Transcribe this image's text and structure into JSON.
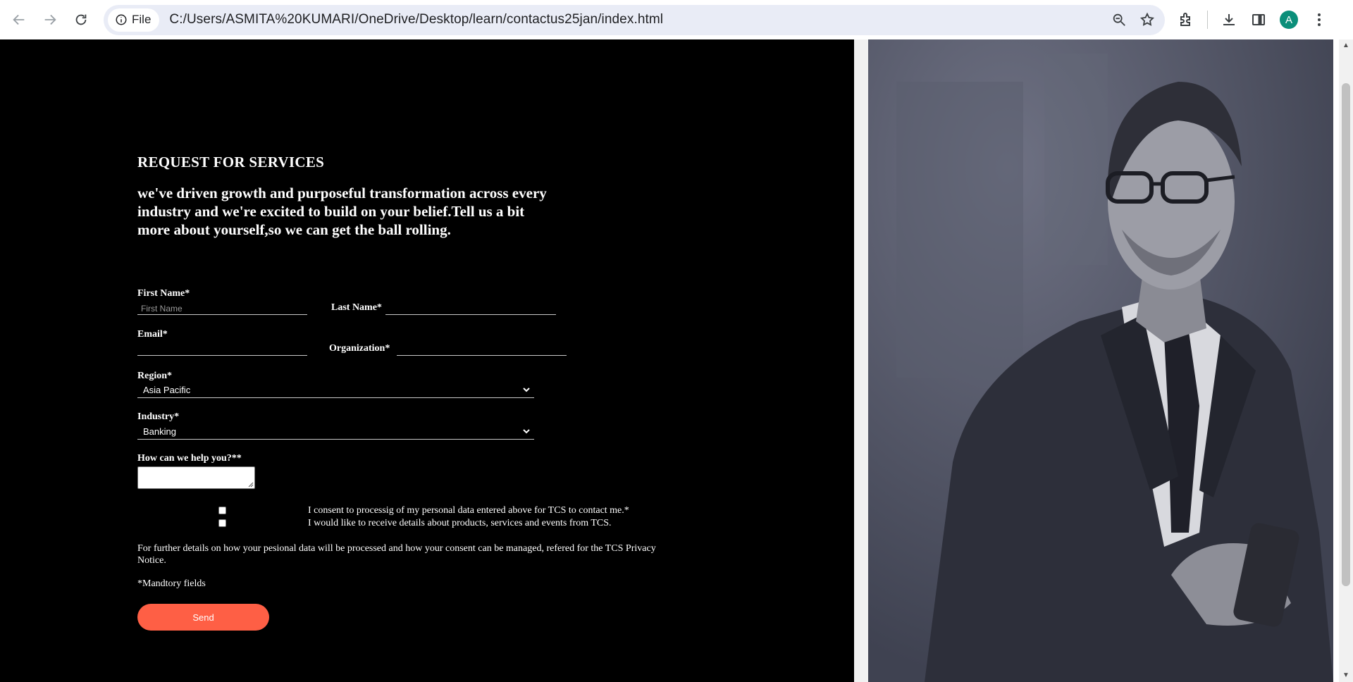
{
  "browser": {
    "site_chip_label": "File",
    "url": "C:/Users/ASMITA%20KUMARI/OneDrive/Desktop/learn/contactus25jan/index.html",
    "profile_initial": "A",
    "icons": [
      "back-icon",
      "forward-icon",
      "reload-icon",
      "info-icon",
      "zoom-icon",
      "star-icon",
      "extensions-icon",
      "download-icon",
      "side-panel-icon",
      "menu-icon"
    ]
  },
  "form": {
    "heading": "REQUEST FOR SERVICES",
    "intro": "we've driven growth and purposeful transformation across every industry and we're excited to build on your belief.Tell us a bit more about yourself,so we can get the ball rolling.",
    "first_name_label": "First Name*",
    "first_name_placeholder": "First Name",
    "last_name_label": "Last Name*",
    "email_label": "Email*",
    "organization_label": "Organization*",
    "region_label": "Region*",
    "region_value": "Asia Pacific",
    "industry_label": "Industry*",
    "industry_value": "Banking",
    "help_label": "How can we help you?**",
    "consent_1": "I consent to processig of my personal data entered above for TCS to contact me.*",
    "consent_2": "I would like to receive details about products, services and events from TCS.",
    "privacy_note": "For further details on how your pesional data will be processed and how your consent can be managed, refered for the TCS Privacy Notice.",
    "mandatory_note": "*Mandtory fields",
    "send_label": "Send"
  },
  "colors": {
    "form_background": "#000000",
    "send_button": "#fe5f45",
    "photo_tint": "#4f5263",
    "avatar": "#0b8f7a"
  }
}
